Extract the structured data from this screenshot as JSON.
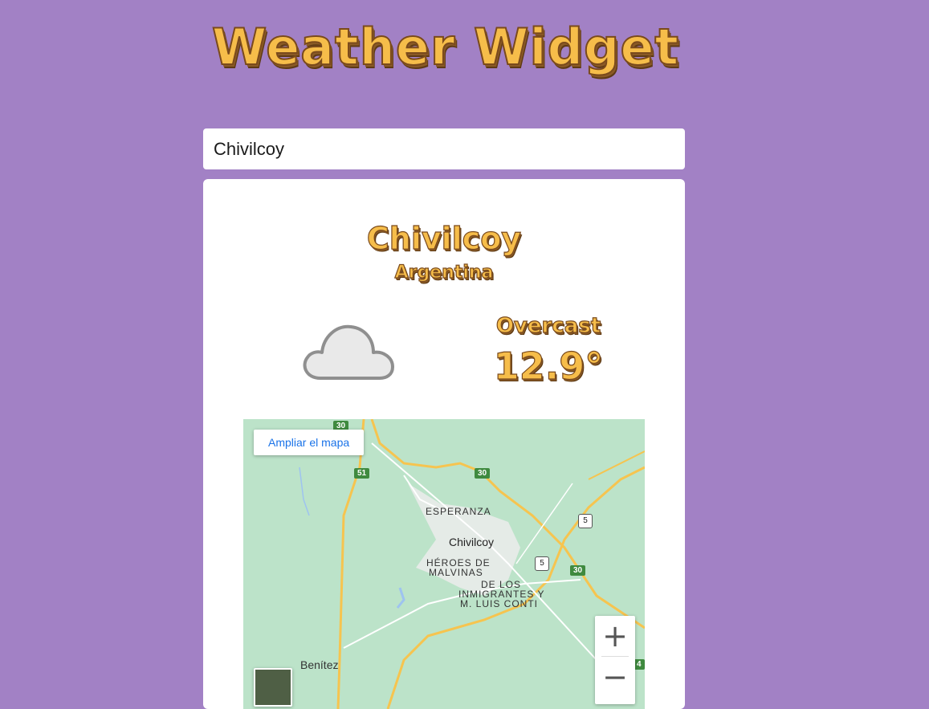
{
  "header": {
    "title": "Weather Widget"
  },
  "search": {
    "value": "Chivilcoy"
  },
  "weather": {
    "city": "Chivilcoy",
    "country": "Argentina",
    "condition": "Overcast",
    "temperature": "12.9°",
    "icon": "cloud-icon"
  },
  "map": {
    "enlarge_label": "Ampliar el mapa",
    "zoom_in_label": "+",
    "zoom_out_label": "−",
    "labels": {
      "esperanza": "ESPERANZA",
      "chivilcoy": "Chivilcoy",
      "heroes_1": "HÉROES DE",
      "heroes_2": "MALVINAS",
      "inmigrantes_1": "DE LOS",
      "inmigrantes_2": "INMIGRANTES Y",
      "inmigrantes_3": "M. LUIS CONTI",
      "benitez": "Benítez"
    },
    "road_shields": {
      "r30": "30",
      "r51": "51",
      "r5": "5",
      "r4": "4"
    },
    "colors": {
      "land": "#bce3c9",
      "highway": "#f6c44f",
      "road_shield": "#3f8a3f"
    }
  }
}
